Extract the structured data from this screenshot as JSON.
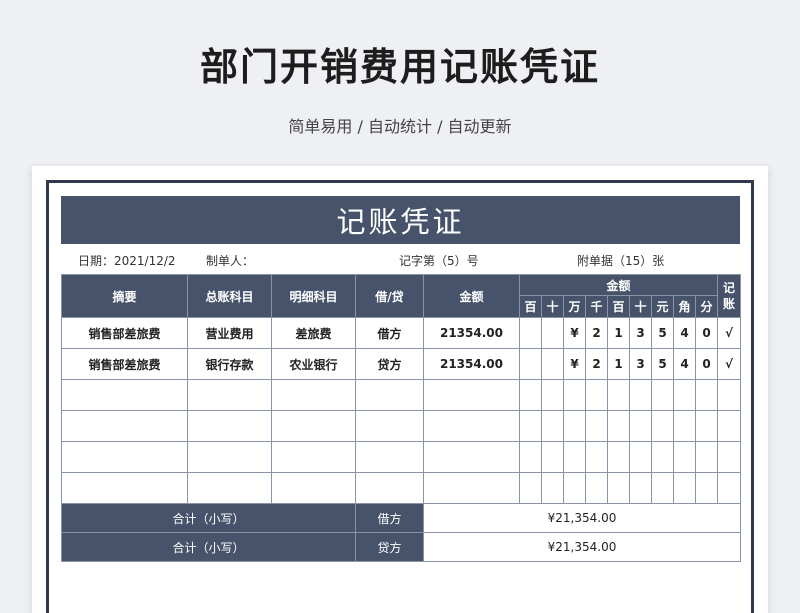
{
  "page": {
    "title": "部门开销费用记账凭证",
    "subtitle": "简单易用 / 自动统计 / 自动更新"
  },
  "voucher": {
    "banner_title": "记账凭证",
    "date_label": "日期：2021/12/2",
    "maker_label": "制单人：",
    "voucher_no": "记字第（5）号",
    "attachments": "附单据（15）张"
  },
  "table": {
    "headers": {
      "summary": "摘要",
      "general_account": "总账科目",
      "detail_account": "明细科目",
      "debit_credit": "借/贷",
      "amount": "金额",
      "amount_group": "金额",
      "bookkeeping": "记账",
      "digits": [
        "百",
        "十",
        "万",
        "千",
        "百",
        "十",
        "元",
        "角",
        "分"
      ]
    },
    "rows": [
      {
        "summary": "销售部差旅费",
        "general_account": "营业费用",
        "detail_account": "差旅费",
        "debit_credit": "借方",
        "amount": "21354.00",
        "digits": [
          "",
          "",
          "¥",
          "2",
          "1",
          "3",
          "5",
          "4",
          "0"
        ],
        "check": "√"
      },
      {
        "summary": "销售部差旅费",
        "general_account": "银行存款",
        "detail_account": "农业银行",
        "debit_credit": "贷方",
        "amount": "21354.00",
        "digits": [
          "",
          "",
          "¥",
          "2",
          "1",
          "3",
          "5",
          "4",
          "0"
        ],
        "check": "√"
      }
    ],
    "empty_rows": 4,
    "totals": [
      {
        "label": "合计（小写）",
        "side": "借方",
        "value": "¥21,354.00"
      },
      {
        "label": "合计（小写）",
        "side": "贷方",
        "value": "¥21,354.00"
      }
    ]
  },
  "colors": {
    "header_bg": "#46536b",
    "frame": "#2f3a4d",
    "background": "#eef0f3"
  }
}
